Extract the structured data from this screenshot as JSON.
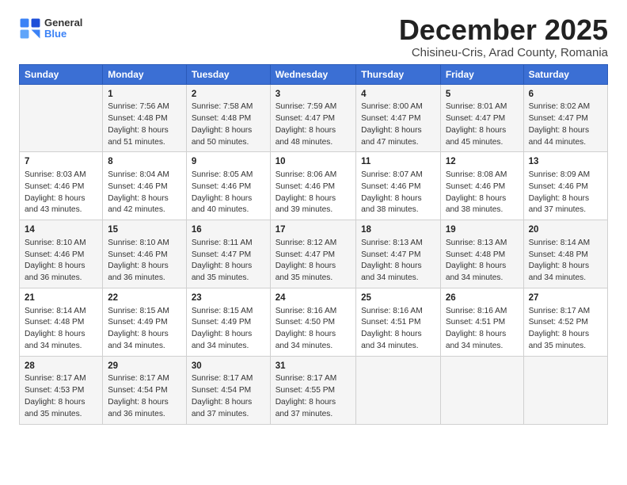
{
  "header": {
    "logo_general": "General",
    "logo_blue": "Blue",
    "title": "December 2025",
    "location": "Chisineu-Cris, Arad County, Romania"
  },
  "columns": [
    "Sunday",
    "Monday",
    "Tuesday",
    "Wednesday",
    "Thursday",
    "Friday",
    "Saturday"
  ],
  "weeks": [
    [
      {
        "day": "",
        "info": ""
      },
      {
        "day": "1",
        "info": "Sunrise: 7:56 AM\nSunset: 4:48 PM\nDaylight: 8 hours\nand 51 minutes."
      },
      {
        "day": "2",
        "info": "Sunrise: 7:58 AM\nSunset: 4:48 PM\nDaylight: 8 hours\nand 50 minutes."
      },
      {
        "day": "3",
        "info": "Sunrise: 7:59 AM\nSunset: 4:47 PM\nDaylight: 8 hours\nand 48 minutes."
      },
      {
        "day": "4",
        "info": "Sunrise: 8:00 AM\nSunset: 4:47 PM\nDaylight: 8 hours\nand 47 minutes."
      },
      {
        "day": "5",
        "info": "Sunrise: 8:01 AM\nSunset: 4:47 PM\nDaylight: 8 hours\nand 45 minutes."
      },
      {
        "day": "6",
        "info": "Sunrise: 8:02 AM\nSunset: 4:47 PM\nDaylight: 8 hours\nand 44 minutes."
      }
    ],
    [
      {
        "day": "7",
        "info": "Sunrise: 8:03 AM\nSunset: 4:46 PM\nDaylight: 8 hours\nand 43 minutes."
      },
      {
        "day": "8",
        "info": "Sunrise: 8:04 AM\nSunset: 4:46 PM\nDaylight: 8 hours\nand 42 minutes."
      },
      {
        "day": "9",
        "info": "Sunrise: 8:05 AM\nSunset: 4:46 PM\nDaylight: 8 hours\nand 40 minutes."
      },
      {
        "day": "10",
        "info": "Sunrise: 8:06 AM\nSunset: 4:46 PM\nDaylight: 8 hours\nand 39 minutes."
      },
      {
        "day": "11",
        "info": "Sunrise: 8:07 AM\nSunset: 4:46 PM\nDaylight: 8 hours\nand 38 minutes."
      },
      {
        "day": "12",
        "info": "Sunrise: 8:08 AM\nSunset: 4:46 PM\nDaylight: 8 hours\nand 38 minutes."
      },
      {
        "day": "13",
        "info": "Sunrise: 8:09 AM\nSunset: 4:46 PM\nDaylight: 8 hours\nand 37 minutes."
      }
    ],
    [
      {
        "day": "14",
        "info": "Sunrise: 8:10 AM\nSunset: 4:46 PM\nDaylight: 8 hours\nand 36 minutes."
      },
      {
        "day": "15",
        "info": "Sunrise: 8:10 AM\nSunset: 4:46 PM\nDaylight: 8 hours\nand 36 minutes."
      },
      {
        "day": "16",
        "info": "Sunrise: 8:11 AM\nSunset: 4:47 PM\nDaylight: 8 hours\nand 35 minutes."
      },
      {
        "day": "17",
        "info": "Sunrise: 8:12 AM\nSunset: 4:47 PM\nDaylight: 8 hours\nand 35 minutes."
      },
      {
        "day": "18",
        "info": "Sunrise: 8:13 AM\nSunset: 4:47 PM\nDaylight: 8 hours\nand 34 minutes."
      },
      {
        "day": "19",
        "info": "Sunrise: 8:13 AM\nSunset: 4:48 PM\nDaylight: 8 hours\nand 34 minutes."
      },
      {
        "day": "20",
        "info": "Sunrise: 8:14 AM\nSunset: 4:48 PM\nDaylight: 8 hours\nand 34 minutes."
      }
    ],
    [
      {
        "day": "21",
        "info": "Sunrise: 8:14 AM\nSunset: 4:48 PM\nDaylight: 8 hours\nand 34 minutes."
      },
      {
        "day": "22",
        "info": "Sunrise: 8:15 AM\nSunset: 4:49 PM\nDaylight: 8 hours\nand 34 minutes."
      },
      {
        "day": "23",
        "info": "Sunrise: 8:15 AM\nSunset: 4:49 PM\nDaylight: 8 hours\nand 34 minutes."
      },
      {
        "day": "24",
        "info": "Sunrise: 8:16 AM\nSunset: 4:50 PM\nDaylight: 8 hours\nand 34 minutes."
      },
      {
        "day": "25",
        "info": "Sunrise: 8:16 AM\nSunset: 4:51 PM\nDaylight: 8 hours\nand 34 minutes."
      },
      {
        "day": "26",
        "info": "Sunrise: 8:16 AM\nSunset: 4:51 PM\nDaylight: 8 hours\nand 34 minutes."
      },
      {
        "day": "27",
        "info": "Sunrise: 8:17 AM\nSunset: 4:52 PM\nDaylight: 8 hours\nand 35 minutes."
      }
    ],
    [
      {
        "day": "28",
        "info": "Sunrise: 8:17 AM\nSunset: 4:53 PM\nDaylight: 8 hours\nand 35 minutes."
      },
      {
        "day": "29",
        "info": "Sunrise: 8:17 AM\nSunset: 4:54 PM\nDaylight: 8 hours\nand 36 minutes."
      },
      {
        "day": "30",
        "info": "Sunrise: 8:17 AM\nSunset: 4:54 PM\nDaylight: 8 hours\nand 37 minutes."
      },
      {
        "day": "31",
        "info": "Sunrise: 8:17 AM\nSunset: 4:55 PM\nDaylight: 8 hours\nand 37 minutes."
      },
      {
        "day": "",
        "info": ""
      },
      {
        "day": "",
        "info": ""
      },
      {
        "day": "",
        "info": ""
      }
    ]
  ]
}
